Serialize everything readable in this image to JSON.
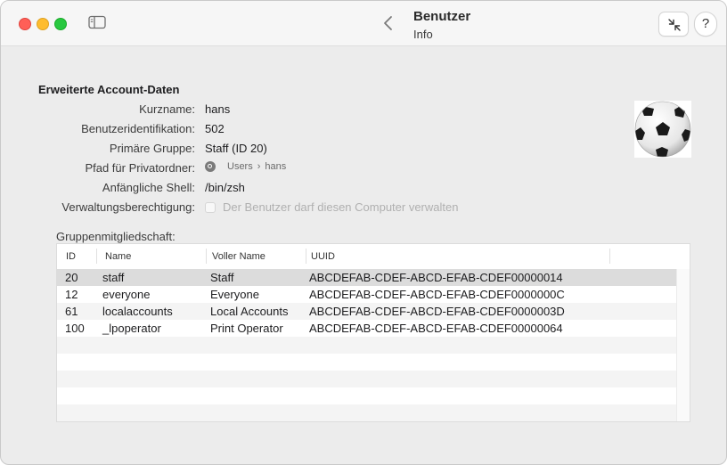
{
  "window": {
    "title": "Benutzer",
    "subtitle": "Info",
    "help_label": "?"
  },
  "details": {
    "section_title": "Erweiterte Account-Daten",
    "rows": [
      {
        "label": "Kurzname:",
        "value": "hans"
      },
      {
        "label": "Benutzeridentifikation:",
        "value": "502"
      },
      {
        "label": "Primäre Gruppe:",
        "value": "Staff (ID 20)"
      },
      {
        "label": "Pfad für Privatordner:",
        "path": [
          "Users",
          "hans"
        ]
      },
      {
        "label": "Anfängliche Shell:",
        "value": "/bin/zsh"
      },
      {
        "label": "Verwaltungsberechtigung:",
        "checkbox_label": "Der Benutzer darf diesen Computer verwalten",
        "checked": false
      }
    ],
    "path_separator": "›",
    "avatar_icon": "soccer-ball-icon"
  },
  "groups": {
    "label": "Gruppenmitgliedschaft:",
    "columns": [
      "ID",
      "Name",
      "Voller Name",
      "UUID"
    ],
    "rows": [
      [
        "20",
        "staff",
        "Staff",
        "ABCDEFAB-CDEF-ABCD-EFAB-CDEF00000014"
      ],
      [
        "12",
        "everyone",
        "Everyone",
        "ABCDEFAB-CDEF-ABCD-EFAB-CDEF0000000C"
      ],
      [
        "61",
        "localaccounts",
        "Local Accounts",
        "ABCDEFAB-CDEF-ABCD-EFAB-CDEF0000003D"
      ],
      [
        "100",
        "_lpoperator",
        "Print Operator",
        "ABCDEFAB-CDEF-ABCD-EFAB-CDEF00000064"
      ]
    ],
    "selected_row": 0
  }
}
